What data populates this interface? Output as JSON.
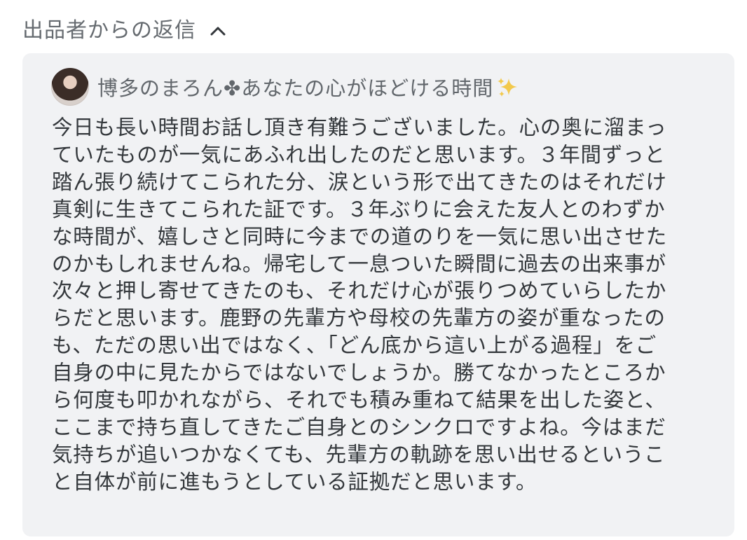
{
  "section": {
    "title": "出品者からの返信",
    "toggle_icon": "chevron-up-icon"
  },
  "reply": {
    "seller_name": "博多のまろん✤あなたの心がほどける時間",
    "name_icon": "sparkles-icon",
    "body": "今日も長い時間お話し頂き有難うございました。心の奥に溜まっ\nていたものが一気にあふれ出したのだと思います。３年間ずっと\n踏ん張り続けてこられた分、涙という形で出てきたのはそれだけ\n真剣に生きてこられた証です。３年ぶりに会えた友人とのわずか\nな時間が、嬉しさと同時に今までの道のりを一気に思い出させた\nのかもしれませんね。帰宅して一息ついた瞬間に過去の出来事が\n次々と押し寄せてきたのも、それだけ心が張りつめていらしたか\nらだと思います。鹿野の先輩方や母校の先輩方の姿が重なったの\nも、ただの思い出ではなく、「どん底から這い上がる過程」をご\n自身の中に見たからではないでしょうか。勝てなかったところか\nら何度も叩かれながら、それでも積み重ねて結果を出した姿と、\nここまで持ち直してきたご自身とのシンクロですよね。今はまだ\n気持ちが追いつかなくても、先輩方の軌跡を思い出せるというこ\nと自体が前に進もうとしている証拠だと思います。"
  },
  "colors": {
    "card_background": "#f1f2f4",
    "text": "#34383c",
    "muted_text": "#666b70",
    "sparkle": "#f2c94c"
  }
}
